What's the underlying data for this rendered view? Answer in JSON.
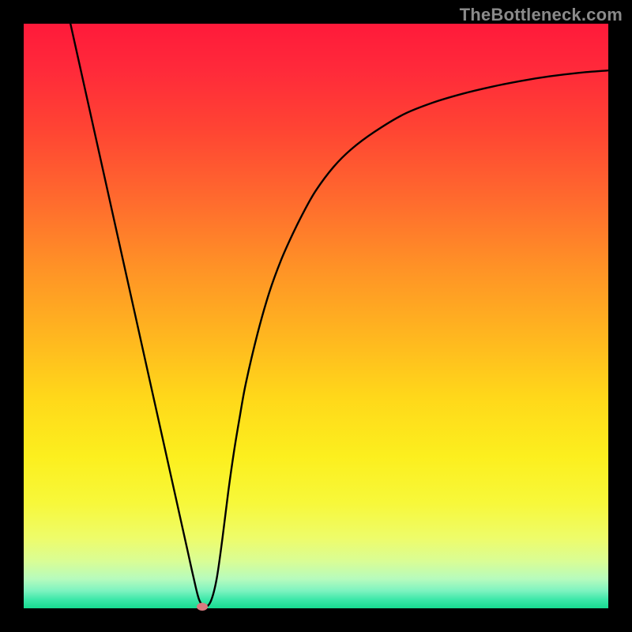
{
  "watermark": "TheBottleneck.com",
  "colors": {
    "frame": "#000000",
    "curve": "#000000",
    "marker": "#d97b80"
  },
  "chart_data": {
    "type": "line",
    "title": "",
    "xlabel": "",
    "ylabel": "",
    "xlim": [
      0,
      100
    ],
    "ylim": [
      0,
      100
    ],
    "grid": false,
    "legend": false,
    "series": [
      {
        "name": "curve",
        "x": [
          8,
          10,
          12,
          14,
          16,
          18,
          20,
          22,
          24,
          26,
          28,
          29,
          30,
          31,
          32,
          33,
          34,
          35,
          36,
          37,
          38,
          40,
          42,
          44,
          46,
          48,
          50,
          53,
          56,
          60,
          65,
          70,
          75,
          80,
          85,
          90,
          95,
          100
        ],
        "y": [
          100,
          91,
          82,
          73,
          64,
          55,
          46,
          37,
          28,
          19,
          10,
          5.5,
          1.5,
          0.3,
          1.2,
          5,
          12,
          20,
          27,
          33,
          38.5,
          47,
          54,
          59.5,
          64,
          68,
          71.5,
          75.5,
          78.5,
          81.5,
          84.5,
          86.5,
          88,
          89.2,
          90.2,
          91,
          91.6,
          92
        ]
      }
    ],
    "marker": {
      "x": 30.5,
      "y": 0.3
    }
  }
}
